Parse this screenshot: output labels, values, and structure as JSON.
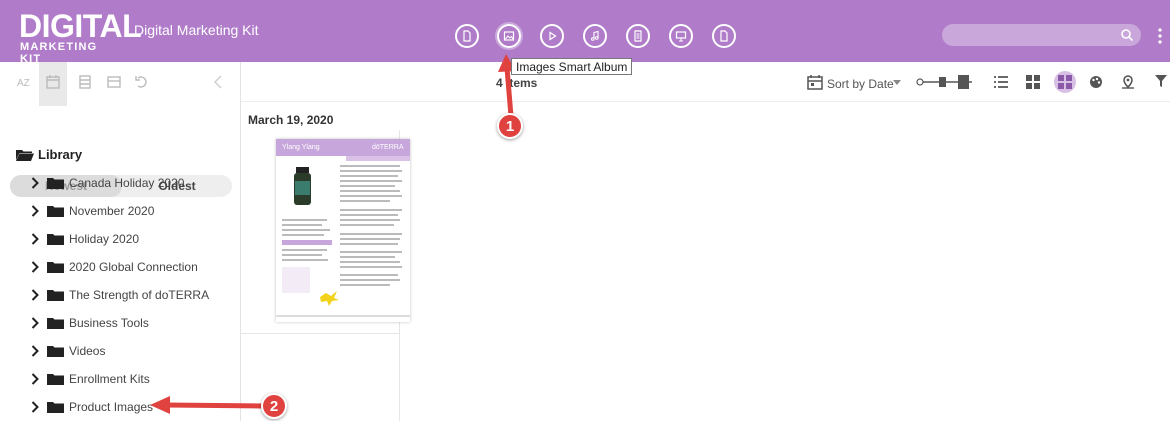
{
  "header": {
    "logo_big": "DIGITAL",
    "logo_small": "MARKETING KIT",
    "app_title": "Digital Marketing Kit",
    "center_icons": [
      {
        "name": "all-files-icon"
      },
      {
        "name": "images-icon"
      },
      {
        "name": "video-icon"
      },
      {
        "name": "audio-icon"
      },
      {
        "name": "documents-icon"
      },
      {
        "name": "presentations-icon"
      },
      {
        "name": "other-files-icon"
      }
    ],
    "search": {
      "placeholder": ""
    }
  },
  "tooltip": "Images Smart Album",
  "left_panel": {
    "sort_newest": "Newest",
    "sort_oldest": "Oldest",
    "library_label": "Library",
    "folders": [
      "Canada Holiday 2020",
      "November 2020",
      "Holiday 2020",
      "2020 Global Connection",
      "The Strength of doTERRA",
      "Business Tools",
      "Videos",
      "Enrollment Kits",
      "Product Images"
    ]
  },
  "toolbar": {
    "item_count": "4 Items",
    "sort_label": "Sort by Date"
  },
  "content": {
    "date_header": "March 19, 2020",
    "thumbnail": {
      "title": "Ylang Ylang",
      "brand": "dōTERRA"
    }
  },
  "annotations": {
    "badge_1": "1",
    "badge_2": "2",
    "color": "#e0423f"
  },
  "colors": {
    "header_bg": "#b07cc9",
    "accent_light": "#d7c0e3"
  }
}
